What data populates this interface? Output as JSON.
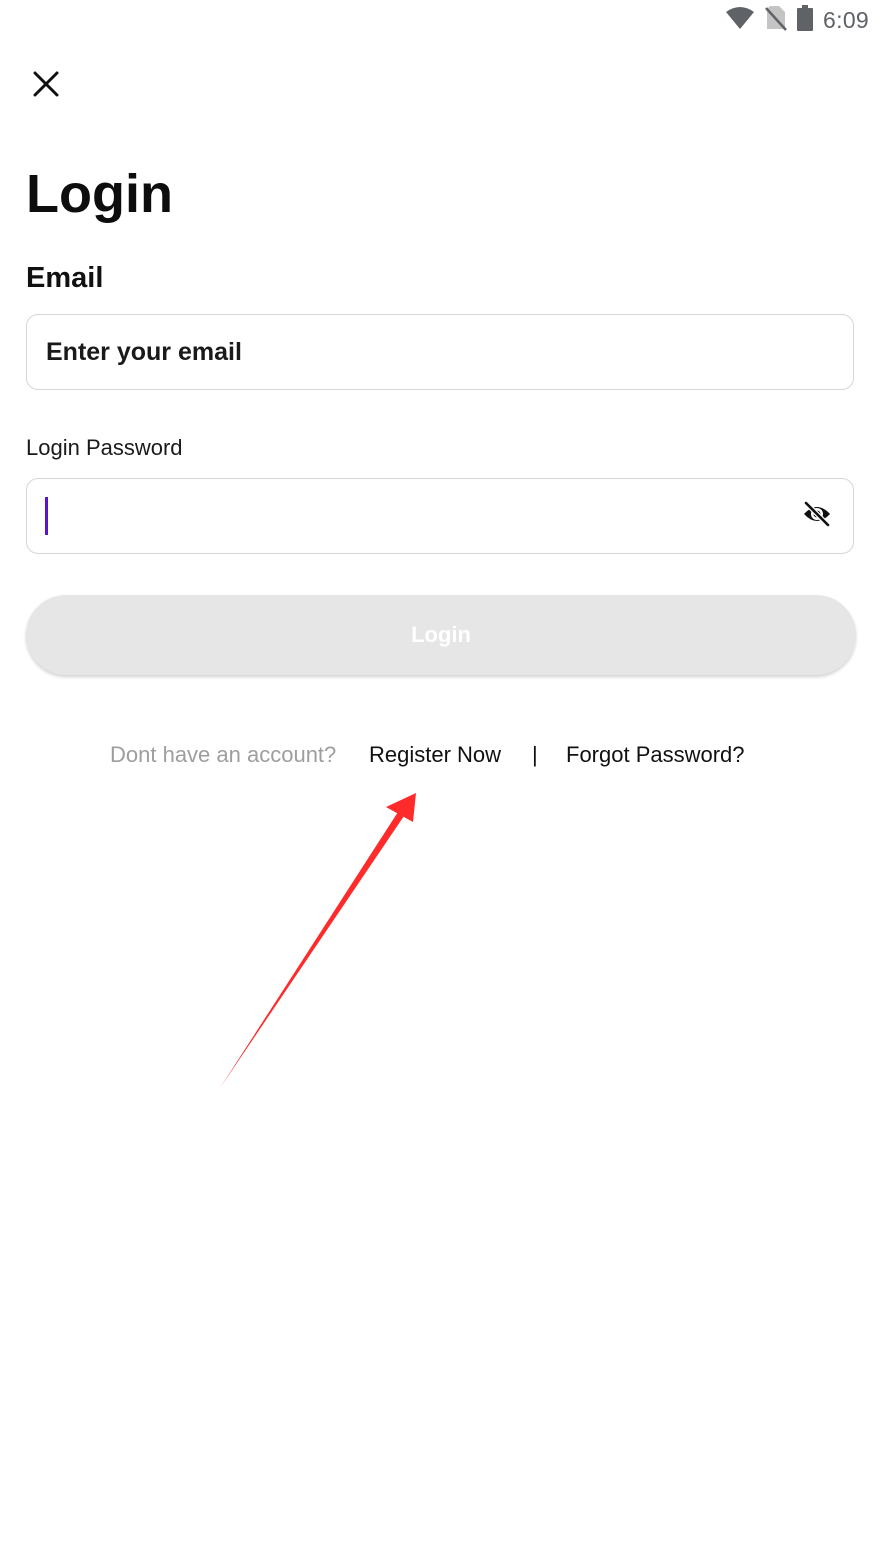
{
  "status_bar": {
    "time": "6:09",
    "icons": [
      "wifi-icon",
      "no-sim-icon",
      "battery-icon"
    ]
  },
  "header": {
    "close_icon": "close-icon"
  },
  "title": "Login",
  "email": {
    "label": "Email",
    "placeholder": "Enter your email",
    "value": ""
  },
  "password": {
    "label": "Login Password",
    "value": "",
    "toggle_icon": "eye-off-icon"
  },
  "login_button": {
    "label": "Login",
    "state": "disabled"
  },
  "footer": {
    "no_account_text": "Dont have an account?",
    "register_label": "Register Now",
    "divider": "|",
    "forgot_label": "Forgot Password?"
  },
  "colors": {
    "caret": "#5b16c8",
    "button_disabled": "#e6e6e6",
    "muted_text": "#9e9e9e",
    "annotation_arrow": "#ff2a2a"
  }
}
